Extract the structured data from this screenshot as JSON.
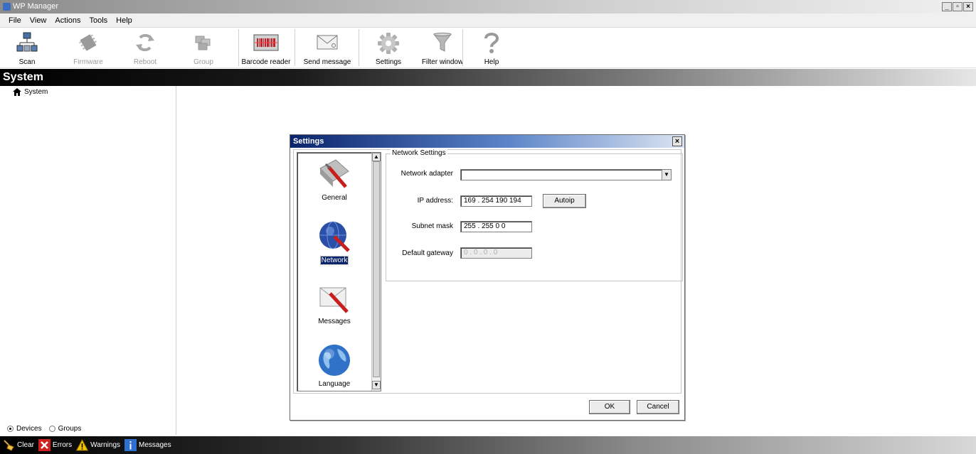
{
  "window": {
    "title": "WP Manager",
    "controls": [
      "_",
      "▫",
      "×"
    ]
  },
  "menu": [
    "File",
    "View",
    "Actions",
    "Tools",
    "Help"
  ],
  "toolbar": {
    "buttons": [
      {
        "label": "Scan",
        "icon": "network-icon"
      },
      {
        "label": "Firmware",
        "icon": "chip-icon"
      },
      {
        "label": "Reboot",
        "icon": "reboot-icon"
      },
      {
        "label": "Group",
        "icon": "group-icon"
      },
      {
        "label": "Barcode reader",
        "icon": "barcode-icon"
      },
      {
        "label": "Send message",
        "icon": "envelope-icon"
      },
      {
        "label": "Settings",
        "icon": "gear-icon"
      },
      {
        "label": "Filter window",
        "icon": "filter-icon"
      },
      {
        "label": "Help",
        "icon": "help-icon"
      }
    ]
  },
  "header": {
    "title": "System"
  },
  "tree": {
    "root_label": "System"
  },
  "view_options": {
    "devices_label": "Devices",
    "groups_label": "Groups",
    "selected": "Devices"
  },
  "statusbar": {
    "clear": "Clear",
    "errors": "Errors",
    "warnings": "Warnings",
    "messages": "Messages"
  },
  "dialog": {
    "title": "Settings",
    "close": "×",
    "categories": [
      {
        "label": "General",
        "icon": "tools-icon"
      },
      {
        "label": "Network",
        "icon": "network-globe-icon"
      },
      {
        "label": "Messages",
        "icon": "messages-tools-icon"
      },
      {
        "label": "Language",
        "icon": "globe-icon"
      }
    ],
    "selected_category": "Network",
    "network": {
      "group_title": "Network Settings",
      "adapter_label": "Network adapter",
      "adapter_value": "",
      "ip_label": "IP address:",
      "ip_value": "169 . 254  190  194",
      "autoip_label": "Autoip",
      "subnet_label": "Subnet mask",
      "subnet_value": "255 . 255   0    0",
      "gateway_label": "Default gateway",
      "gateway_value": "0  .  0  .  0  .  0"
    },
    "ok_label": "OK",
    "cancel_label": "Cancel"
  },
  "colors": {
    "dialog_title": "#0a246a",
    "header_dark": "#000000",
    "accent_red": "#c0202a"
  }
}
